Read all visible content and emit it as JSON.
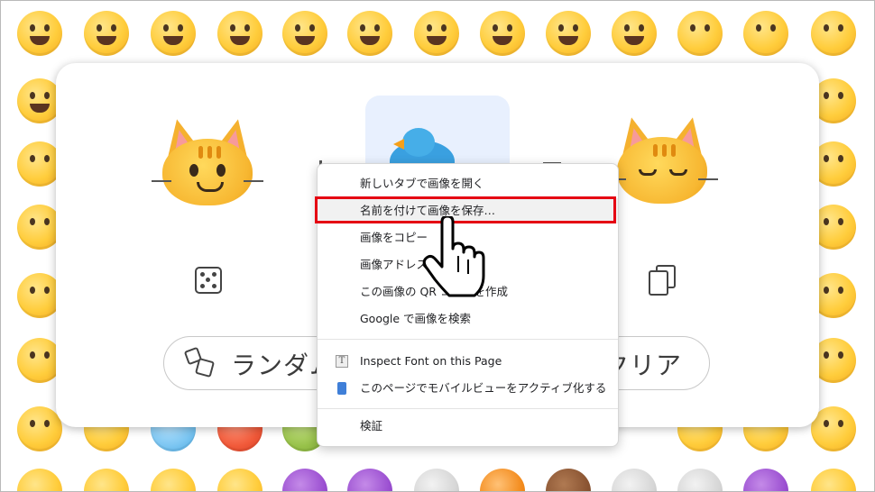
{
  "menu": {
    "items": [
      {
        "label": "新しいタブで画像を開く"
      },
      {
        "label": "名前を付けて画像を保存…"
      },
      {
        "label": "画像をコピー"
      },
      {
        "label": "画像アドレス"
      },
      {
        "label": "この画像の QR コードを作成"
      },
      {
        "label": "Google で画像を検索"
      },
      {
        "label": "Inspect Font on this Page"
      },
      {
        "label": "このページでモバイルビューをアクティブ化する"
      },
      {
        "label": "検証"
      }
    ]
  },
  "buttons": {
    "random_label": "ランダム",
    "clear_label": "クリア"
  },
  "icons": {
    "dice": "dice-icon",
    "copy": "copy-icon",
    "font_extension": "font-extension-icon",
    "mobile_extension": "mobile-extension-icon"
  },
  "colors": {
    "highlight_box": "#e50012",
    "selected_tile": "#e8f0fe"
  }
}
